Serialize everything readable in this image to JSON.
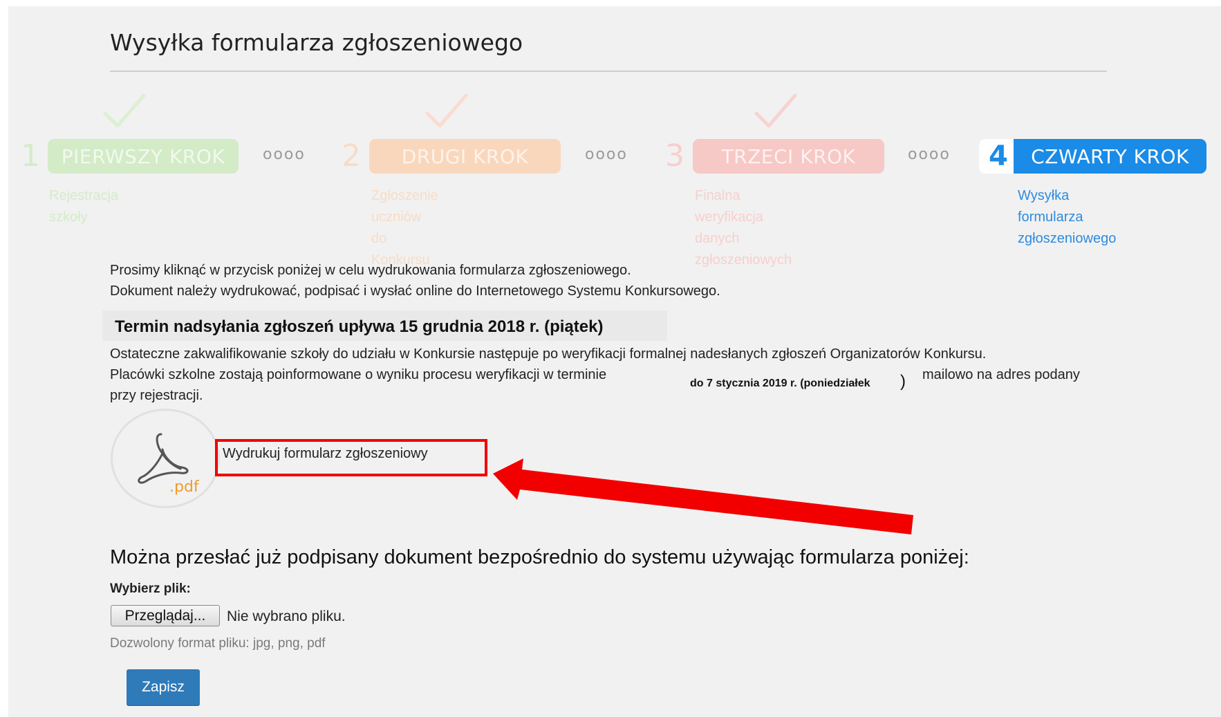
{
  "page": {
    "title": "Wysyłka formularza zgłoszeniowego"
  },
  "steps": [
    {
      "number": "1",
      "label": "PIERWSZY KROK",
      "desc_line1": "Rejestracja szkoły",
      "desc_line2": "",
      "state": "completed"
    },
    {
      "number": "2",
      "label": "DRUGI KROK",
      "desc_line1": "Zgłoszenie uczniów do",
      "desc_line2": "Konkursu",
      "state": "completed"
    },
    {
      "number": "3",
      "label": "TRZECI KROK",
      "desc_line1": "Finalna weryfikacja danych",
      "desc_line2": "zgłoszeniowych",
      "state": "completed"
    },
    {
      "number": "4",
      "label": "CZWARTY KROK",
      "desc_line1": "Wysyłka formularza",
      "desc_line2": "zgłoszeniowego",
      "state": "active"
    }
  ],
  "step_separator": "oooo",
  "instructions": {
    "line1": "Prosimy kliknąć w przycisk poniżej w celu wydrukowania formularza zgłoszeniowego.",
    "line2": "Dokument należy wydrukować, podpisać  i wysłać online do Internetowego Systemu Konkursowego."
  },
  "deadline": "Termin nadsyłania zgłoszeń upływa 15 grudnia 2018 r. (piątek)",
  "qualification": {
    "line1": "Ostateczne zakwalifikowanie szkoły do udziału w Konkursie następuje po weryfikacji formalnej nadesłanych zgłoszeń Organizatorów Konkursu.",
    "line2_start": "Placówki szkolne zostają poinformowane o wyniku procesu weryfikacji w terminie",
    "line2_date": "do 7 stycznia 2019 r. (poniedziałek",
    "line2_paren": ")",
    "line2_end": "mailowo na adres podany",
    "line3": "przy rejestracji."
  },
  "pdf": {
    "icon_label": ".pdf",
    "link_text": "Wydrukuj formularz zgłoszeniowy"
  },
  "upload": {
    "heading": "Można przesłać już podpisany dokument bezpośrednio do systemu używając formularza poniżej:",
    "choose_label": "Wybierz plik:",
    "browse_button": "Przeglądaj...",
    "no_file": "Nie wybrano pliku.",
    "allowed_formats": "Dozwolony format pliku: jpg, png, pdf",
    "save_button": "Zapisz"
  },
  "colors": {
    "accent_blue": "#1a8be7",
    "step1_green": "#d3ebc7",
    "step2_orange": "#f9d7bd",
    "step3_red": "#f6c8c6",
    "annotation_red": "#f20000",
    "save_button": "#2f7ab8"
  }
}
